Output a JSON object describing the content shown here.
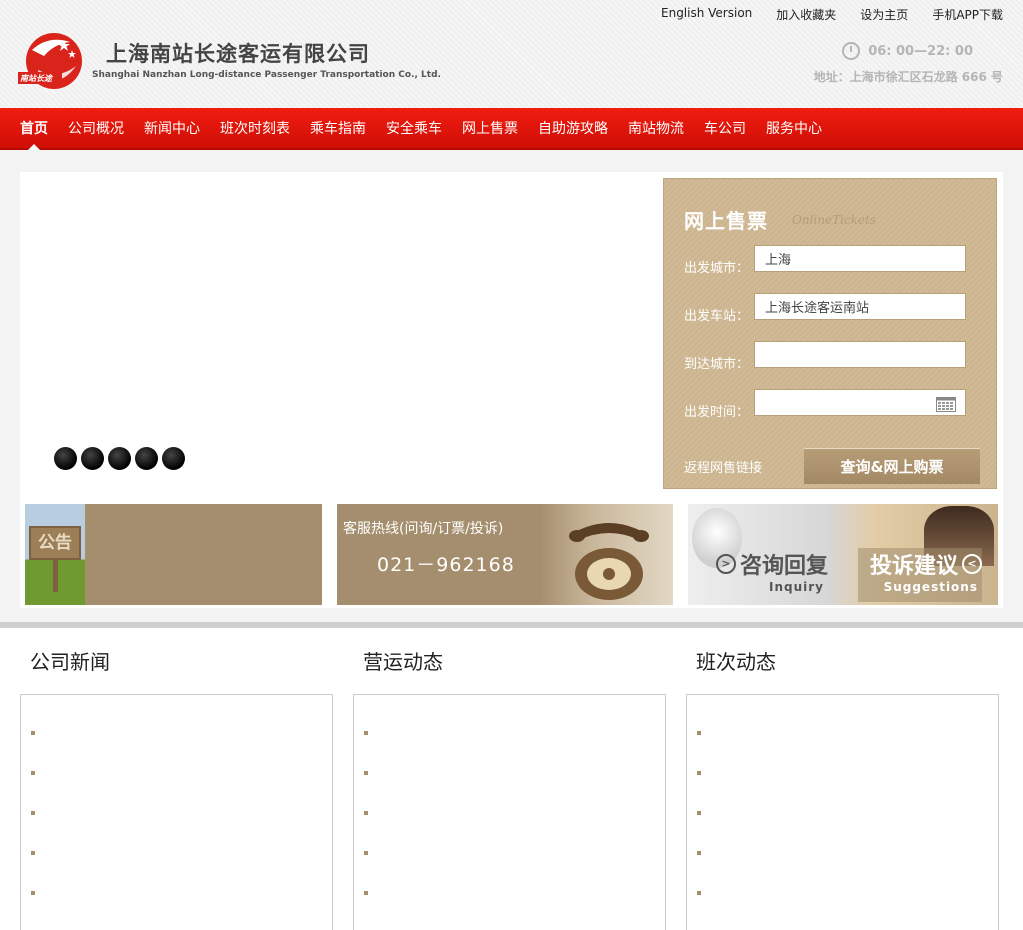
{
  "header": {
    "top_links": [
      "English Version",
      "加入收藏夹",
      "设为主页",
      "手机APP下载"
    ],
    "brand_cn": "上海南站长途客运有限公司",
    "brand_en": "Shanghai Nanzhan Long-distance Passenger Transportation Co., Ltd.",
    "logo_text": "南站长途",
    "hours": "06: 00—22: 00",
    "address": "地址：上海市徐汇区石龙路 666 号",
    "colors": {
      "brand_red": "#e4110a",
      "logo_red": "#d9241b"
    }
  },
  "nav": {
    "items": [
      "首页",
      "公司概况",
      "新闻中心",
      "班次时刻表",
      "乘车指南",
      "安全乘车",
      "网上售票",
      "自助游攻略",
      "南站物流",
      "车公司",
      "服务中心"
    ]
  },
  "slider": {
    "dot_count": 5
  },
  "ticket": {
    "title": "网上售票",
    "subtitle": "OnlineTickets",
    "fields": [
      {
        "label": "出发城市：",
        "value": "上海"
      },
      {
        "label": "出发车站：",
        "value": "上海长途客运南站"
      },
      {
        "label": "到达城市：",
        "value": ""
      },
      {
        "label": "出发时间：",
        "value": ""
      }
    ],
    "return_link": "返程网售链接",
    "query_button": "查询&网上购票",
    "colors": {
      "panel": "#cfb894",
      "button": "#ad9470"
    }
  },
  "banners": {
    "notice_sign": "公告",
    "hotline_label": "客服热线(问询/订票/投诉)",
    "hotline_number": "021－962168",
    "inquiry": {
      "cn": "咨询回复",
      "en": "Inquiry"
    },
    "suggestions": {
      "cn": "投诉建议",
      "en": "Suggestions"
    }
  },
  "columns": [
    {
      "title": "公司新闻"
    },
    {
      "title": "营运动态"
    },
    {
      "title": "班次动态"
    }
  ]
}
